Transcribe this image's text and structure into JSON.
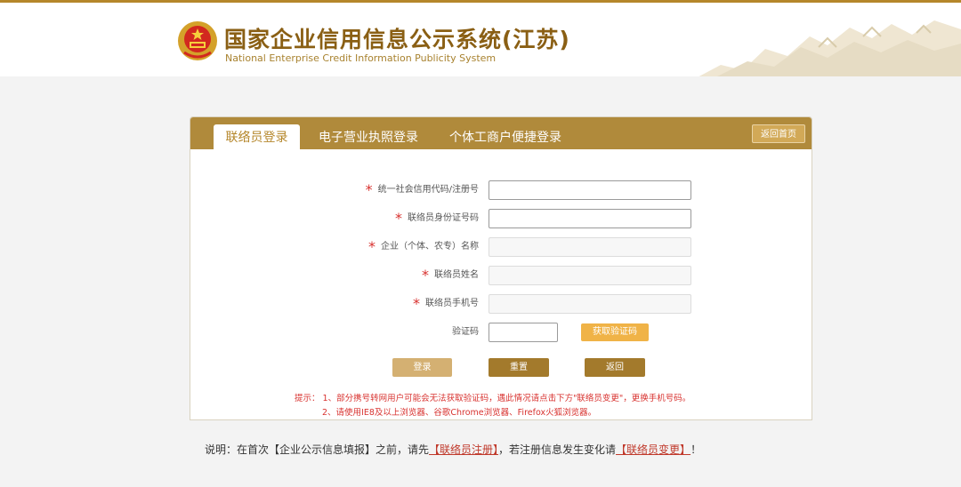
{
  "header": {
    "title": "国家企业信用信息公示系统(江苏)",
    "subtitle": "National Enterprise Credit Information Publicity System"
  },
  "tabs": [
    {
      "label": "联络员登录",
      "active": true
    },
    {
      "label": "电子营业执照登录",
      "active": false
    },
    {
      "label": "个体工商户便捷登录",
      "active": false
    }
  ],
  "home_button": "返回首页",
  "form": {
    "credit_code_label": "统一社会信用代码/注册号",
    "id_number_label": "联络员身份证号码",
    "company_name_label": "企业（个体、农专）名称",
    "contact_name_label": "联络员姓名",
    "phone_label": "联络员手机号",
    "captcha_label": "验证码",
    "get_code_button": "获取验证码",
    "required_mark": "*"
  },
  "buttons": {
    "login": "登录",
    "reset": "重置",
    "back": "返回"
  },
  "tips": {
    "line1": "提示：  1、部分携号转网用户可能会无法获取验证码，遇此情况请点击下方\"联络员变更\"，更换手机号码。",
    "line2": "2、请使用IE8及以上浏览器、谷歌Chrome浏览器、Firefox火狐浏览器。"
  },
  "note": {
    "prefix": "说明：在首次【企业公示信息填报】之前，请先",
    "link_register": "【联络员注册】",
    "middle": "，若注册信息发生变化请",
    "link_change": "【联络员变更】",
    "suffix": "！"
  },
  "colors": {
    "brand_gold": "#b08a3b",
    "required_red": "#d8322f",
    "button_orange": "#f0b347"
  }
}
